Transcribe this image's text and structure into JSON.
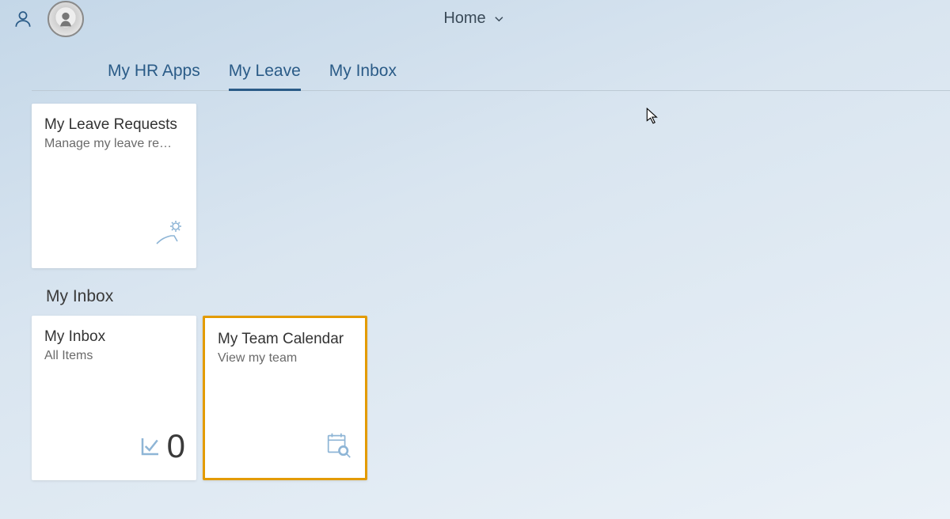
{
  "header": {
    "home_label": "Home"
  },
  "tabs": [
    {
      "label": "My HR Apps",
      "active": false
    },
    {
      "label": "My Leave",
      "active": true
    },
    {
      "label": "My Inbox",
      "active": false
    }
  ],
  "tiles": {
    "leave_requests": {
      "title": "My Leave Requests",
      "subtitle": "Manage my leave re…"
    },
    "inbox": {
      "title": "My Inbox",
      "subtitle": "All Items",
      "count": "0"
    },
    "team_calendar": {
      "title": "My Team Calendar",
      "subtitle": "View my team"
    }
  },
  "sections": {
    "my_inbox": "My Inbox"
  }
}
